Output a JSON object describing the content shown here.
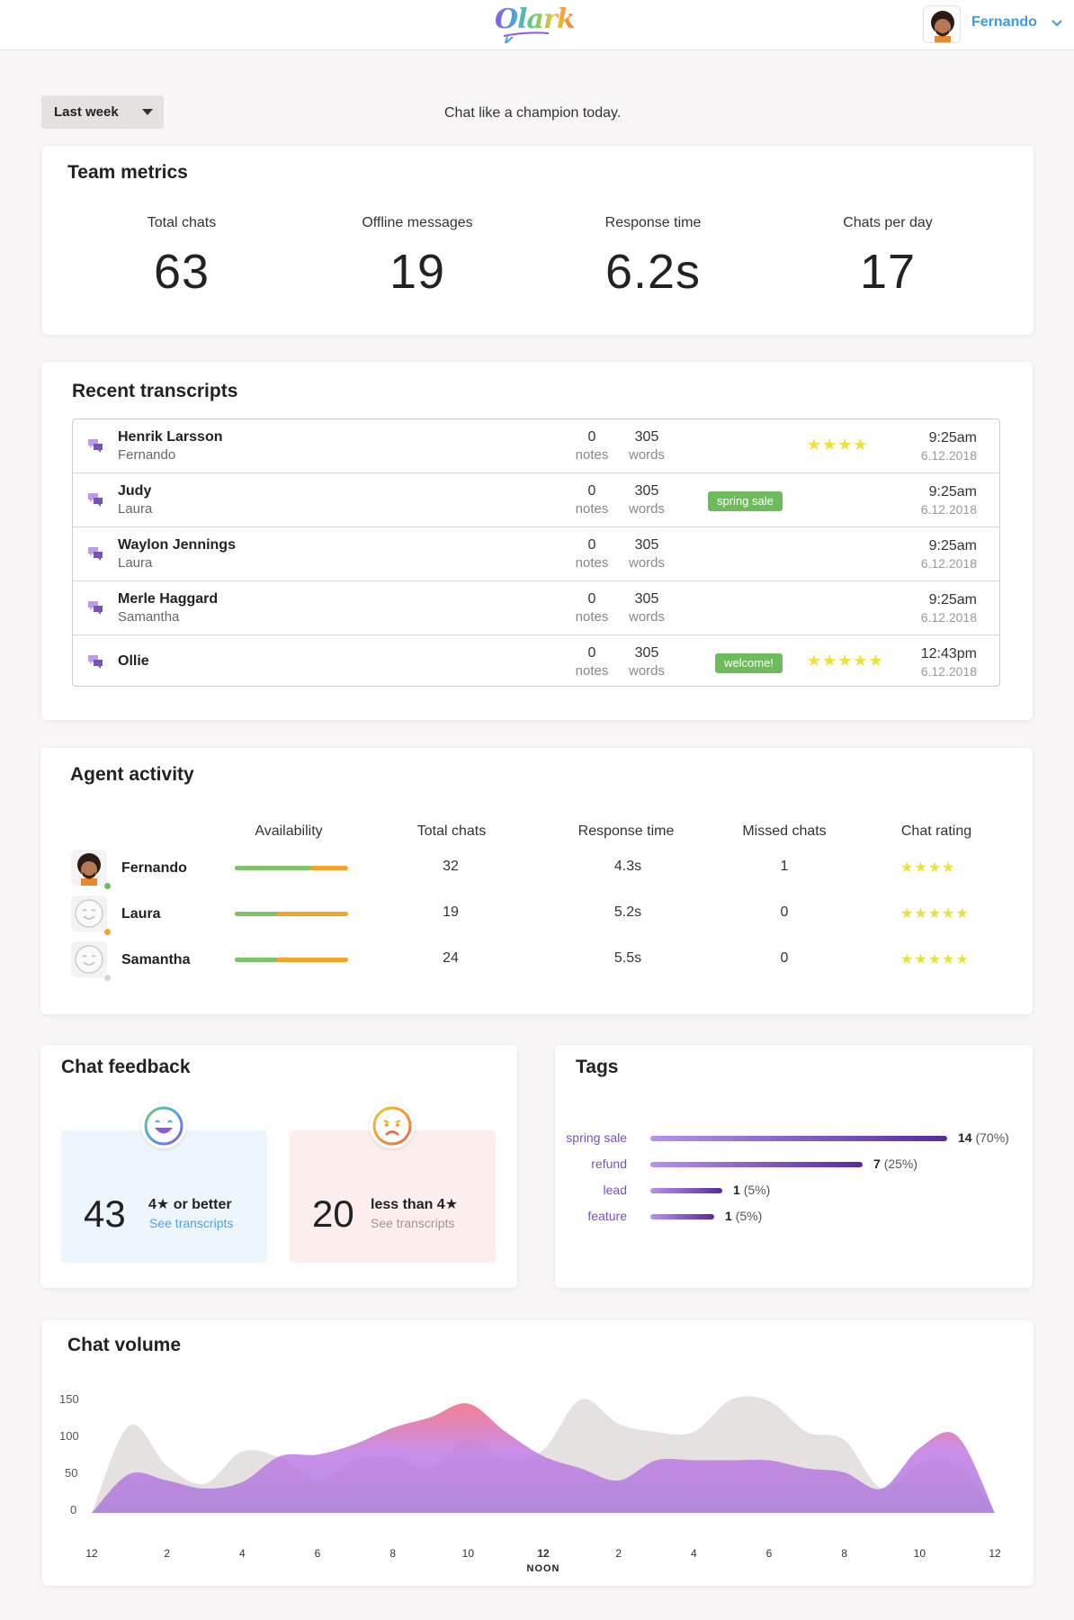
{
  "header": {
    "logo_text": "Olark",
    "user_name": "Fernando",
    "icons": {
      "menu": "chevron-down-icon"
    }
  },
  "toolbar": {
    "range_label": "Last week",
    "tagline": "Chat like a champion today."
  },
  "team_metrics": {
    "title": "Team metrics",
    "items": [
      {
        "label": "Total chats",
        "value": "63"
      },
      {
        "label": "Offline messages",
        "value": "19"
      },
      {
        "label": "Response time",
        "value": "6.2s"
      },
      {
        "label": "Chats per day",
        "value": "17"
      }
    ]
  },
  "transcripts": {
    "title": "Recent transcripts",
    "rows": [
      {
        "name": "Henrik Larsson",
        "agent": "Fernando",
        "notes": "0",
        "notes_label": "notes",
        "words": "305",
        "words_label": "words",
        "tag": "",
        "stars": "★★★★",
        "time": "9:25am",
        "date": "6.12.2018"
      },
      {
        "name": "Judy",
        "agent": "Laura",
        "notes": "0",
        "notes_label": "notes",
        "words": "305",
        "words_label": "words",
        "tag": "spring sale",
        "stars": "",
        "time": "9:25am",
        "date": "6.12.2018"
      },
      {
        "name": "Waylon Jennings",
        "agent": "Laura",
        "notes": "0",
        "notes_label": "notes",
        "words": "305",
        "words_label": "words",
        "tag": "",
        "stars": "",
        "time": "9:25am",
        "date": "6.12.2018"
      },
      {
        "name": "Merle Haggard",
        "agent": "Samantha",
        "notes": "0",
        "notes_label": "notes",
        "words": "305",
        "words_label": "words",
        "tag": "",
        "stars": "",
        "time": "9:25am",
        "date": "6.12.2018"
      },
      {
        "name": "Ollie",
        "agent": "",
        "notes": "0",
        "notes_label": "notes",
        "words": "305",
        "words_label": "words",
        "tag": "welcome!",
        "stars": "★★★★★",
        "time": "12:43pm",
        "date": "6.12.2018"
      }
    ]
  },
  "agent_activity": {
    "title": "Agent activity",
    "headers": [
      "Availability",
      "Total chats",
      "Response time",
      "Missed chats",
      "Chat rating"
    ],
    "agents": [
      {
        "name": "Fernando",
        "availability_green": 0.67,
        "status_color": "#6dbb5a",
        "total_chats": "32",
        "response_time": "4.3s",
        "missed_chats": "1",
        "rating": "★★★★"
      },
      {
        "name": "Laura",
        "availability_green": 0.37,
        "status_color": "#f2a42b",
        "total_chats": "19",
        "response_time": "5.2s",
        "missed_chats": "0",
        "rating": "★★★★★"
      },
      {
        "name": "Samantha",
        "availability_green": 0.37,
        "status_color": "#d6d3d3",
        "total_chats": "24",
        "response_time": "5.5s",
        "missed_chats": "0",
        "rating": "★★★★★"
      }
    ]
  },
  "feedback": {
    "title": "Chat feedback",
    "positive": {
      "count": "43",
      "label": "4★ or better",
      "link": "See transcripts"
    },
    "negative": {
      "count": "20",
      "label": "less than 4★",
      "link": "See transcripts"
    }
  },
  "tags": {
    "title": "Tags",
    "items": [
      {
        "label": "spring sale",
        "count": "14",
        "pct": "(70%)",
        "fraction": 0.7
      },
      {
        "label": "refund",
        "count": "7",
        "pct": "(25%)",
        "fraction": 0.5
      },
      {
        "label": "lead",
        "count": "1",
        "pct": "(5%)",
        "fraction": 0.17
      },
      {
        "label": "feature",
        "count": "1",
        "pct": "(5%)",
        "fraction": 0.15
      }
    ]
  },
  "chart_data": {
    "type": "area",
    "title": "Chat volume",
    "ylim": [
      0,
      150
    ],
    "yticks": [
      "150",
      "100",
      "50",
      "0"
    ],
    "xticks": [
      "12",
      "2",
      "4",
      "6",
      "8",
      "10",
      "12",
      "2",
      "4",
      "6",
      "8",
      "10",
      "12"
    ],
    "noon_label": "NOON",
    "x": [
      0,
      1,
      2,
      3,
      4,
      5,
      6,
      7,
      8,
      9,
      10,
      11,
      12,
      13,
      14,
      15,
      16,
      17,
      18,
      19,
      20,
      21,
      22,
      23,
      24
    ],
    "series": [
      {
        "values": [
          0,
          108,
          58,
          36,
          76,
          68,
          40,
          65,
          70,
          55,
          90,
          65,
          78,
          140,
          110,
          100,
          100,
          140,
          138,
          100,
          90,
          30,
          60,
          60,
          0
        ],
        "color": "#e6e1e1"
      },
      {
        "values": [
          0,
          48,
          40,
          30,
          38,
          70,
          72,
          85,
          105,
          118,
          135,
          100,
          70,
          55,
          40,
          65,
          65,
          65,
          65,
          55,
          50,
          30,
          80,
          95,
          0
        ],
        "color": "gradient"
      }
    ]
  }
}
